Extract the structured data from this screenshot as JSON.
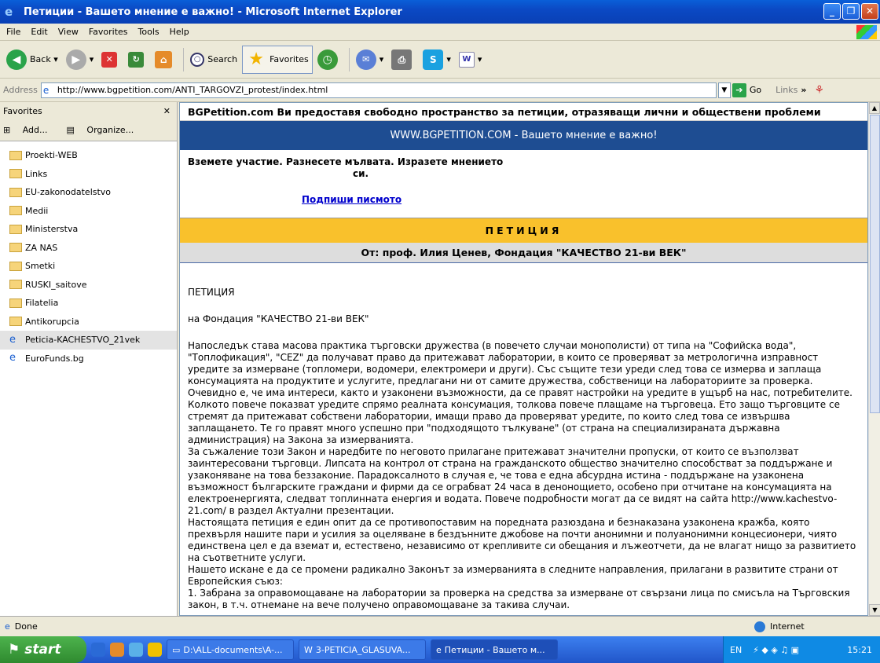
{
  "window": {
    "title": "Петиции - Вашето мнение е важно! - Microsoft Internet Explorer"
  },
  "menu": [
    "File",
    "Edit",
    "View",
    "Favorites",
    "Tools",
    "Help"
  ],
  "toolbar": {
    "back": "Back",
    "search": "Search",
    "favorites": "Favorites"
  },
  "address": {
    "label": "Address",
    "url": "http://www.bgpetition.com/ANTI_TARGOVZI_protest/index.html",
    "go": "Go",
    "links": "Links"
  },
  "favorites": {
    "title": "Favorites",
    "add": "Add...",
    "organize": "Organize...",
    "items": [
      {
        "label": "Proekti-WEB",
        "type": "folder"
      },
      {
        "label": "Links",
        "type": "folder"
      },
      {
        "label": "EU-zakonodatelstvo",
        "type": "folder"
      },
      {
        "label": "Medii",
        "type": "folder"
      },
      {
        "label": "Ministerstva",
        "type": "folder"
      },
      {
        "label": "ZA NAS",
        "type": "folder"
      },
      {
        "label": "Smetki",
        "type": "folder"
      },
      {
        "label": "RUSKI_saitove",
        "type": "folder"
      },
      {
        "label": "Filatelia",
        "type": "folder"
      },
      {
        "label": "Antikorupcia",
        "type": "folder"
      },
      {
        "label": "Peticia-KACHESTVO_21vek",
        "type": "page"
      },
      {
        "label": "EuroFunds.bg",
        "type": "page"
      }
    ]
  },
  "page": {
    "intro": "BGPetition.com Ви предоставя свободно пространство за петиции, отразяващи лични и обществени проблеми",
    "banner": "WWW.BGPETITION.COM - Вашето мнение е важно!",
    "participate_line1": "Вземете участие. Разнесете мълвата. Изразете мнението",
    "participate_line2": "си.",
    "sign_link": "Подпиши писмото",
    "petition_header": "ПЕТИЦИЯ",
    "from": "От: проф. Илия Ценев, Фондация \"КАЧЕСТВО 21-ви ВЕК\"",
    "body_title": "ПЕТИЦИЯ",
    "body_subtitle": "на Фондация \"КАЧЕСТВО 21-ви ВЕК\"",
    "body_text": "Напоследък става масова практика търговски дружества (в повечето случаи монополисти) от типа на \"Софийска вода\", \"Топлофикация\", \"CEZ\" да получават право да притежават лаборатории, в които се проверяват за метрологична изправност уредите за измерване (топломери, водомери, електромери и други). Със същите тези уреди след това се измерва и заплаща консумацията на продуктите и услугите, предлагани ни от самите дружества, собственици на лабораториите за проверка.\nОчевидно е, че има интереси, както и узаконени възможности, да се правят настройки на уредите в ущърб на нас, потребителите. Колкото повече показват уредите спрямо реалната консумация, толкова повече плащаме на търговеца. Ето защо търговците се стремят да притежават собствени лаборатории, имащи право да проверяват уредите, по които след това се извършва заплащането. Те го правят много успешно при \"подходящото тълкуване\" (от страна на специализираната държавна администрация) на Закона за измерванията.\nЗа съжаление този Закон и наредбите по неговото прилагане притежават значителни пропуски, от които се възползват заинтересовани търговци. Липсата на контрол от страна на гражданското общество значително способстват за поддържане и узаконяване на това беззаконие. Парадоксалното в случая е, че това е една абсурдна истина - поддържане на узаконена възможност българските граждани и фирми да се ограбват 24 часа в денонощието, особено при отчитане на консумацията на електроенергията, следват топлинната енергия и водата. Повече подробности могат да се видят на сайта http://www.kachestvo-21.com/ в раздел Актуални презентации.\nНастоящата петиция е един опит да се противопоставим на поредната разюздана и безнаказана узаконена кражба, която прехвърля нашите пари и усилия за оцеляване в бездънните джобове на почти анонимни и полуанонимни концесионери, чиято единствена цел е да вземат и, естествено, независимо от крепливите си обещания и лъжеотчети, да не влагат нищо за развитието на съответните услуги.\nНашето искане е да се промени радикално Законът за измерванията в следните направления, прилагани в развитите страни от Европейския съюз:\n1. Забрана за оправомощаване на лаборатории за проверка на средства за измерване от свързани лица по смисъла на Търговския закон, в т.ч. отнемане на вече получено оправомощаване за такива случаи."
  },
  "status": {
    "text": "Done",
    "zone": "Internet"
  },
  "taskbar": {
    "start": "start",
    "tasks": [
      {
        "label": "D:\\ALL-documents\\A-..."
      },
      {
        "label": "3-PETICIA_GLASUVA..."
      },
      {
        "label": "Петиции - Вашето м..."
      }
    ],
    "lang": "EN",
    "clock": "15:21"
  }
}
